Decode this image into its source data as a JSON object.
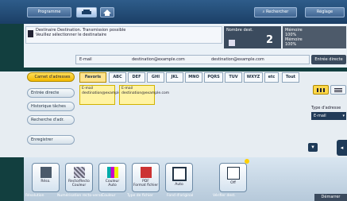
{
  "topbar": {
    "program_label": "Programme",
    "copy_button": "",
    "search_label": "Rechercher",
    "settings_label": "Réglage"
  },
  "message": {
    "line1": "Destinaire Destination. Transmission possible",
    "line2": "Veuillez sélectionner le destinataire"
  },
  "jobs": {
    "label": "Nombre dest.",
    "count": "2"
  },
  "memory": {
    "line1": "Mémoire",
    "line2": "100%",
    "line3": "Mémoire",
    "line4": "100%"
  },
  "address_bar": {
    "fields": [
      "E-mail",
      "destination@example.com",
      "destination@example.com"
    ],
    "advanced_button": "Entrée directe"
  },
  "left_tabs": {
    "address_book": "Carnet d'adresses",
    "direct_input": "Entrée directe",
    "job_history": "Historique tâches",
    "address_search": "Recherche d'adr.",
    "registration": "Enregistrer"
  },
  "index_tabs": [
    "Favoris",
    "ABC",
    "DEF",
    "GHI",
    "JKL",
    "MNO",
    "PQRS",
    "TUV",
    "WXYZ",
    "etc",
    "Tout"
  ],
  "destinations": [
    {
      "label": "E-mail",
      "name": "destination@example.com"
    },
    {
      "label": "E-mail",
      "name": "destination@example.com"
    }
  ],
  "right_panel": {
    "type_label": "Type d'adresse",
    "type_value": "E-mail"
  },
  "tiles": [
    {
      "name": "Réso.",
      "sub": "Réglages"
    },
    {
      "name": "Recto/Recto",
      "sub": "Couleur"
    },
    {
      "name": "Couleur",
      "sub": "Auto"
    },
    {
      "name": "PDF",
      "sub": "Format fichier"
    },
    {
      "name": "Auto",
      "sub": "Fond d'original"
    },
    {
      "name": "Off",
      "sub": "Vérification"
    }
  ],
  "bottom_labels": [
    "Résolution",
    "Numérisation recto-verso",
    "Couleur",
    "Type de fichier",
    "Fond d'original",
    "Vérifier dest."
  ],
  "start_label": "Démarrer"
}
